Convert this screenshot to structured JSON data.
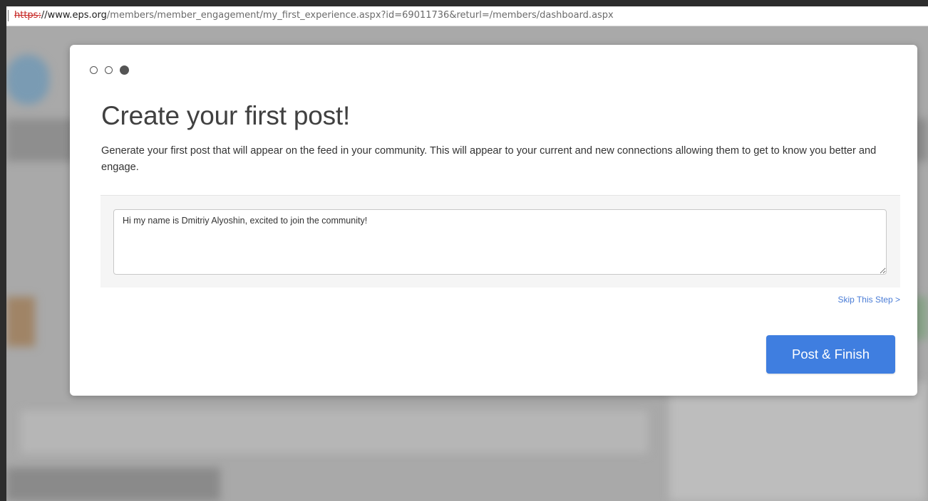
{
  "browser": {
    "url_scheme": "https:",
    "url_host": "//www.eps.org",
    "url_path": "/members/member_engagement/my_first_experience.aspx?id=69011736&returl=/members/dashboard.aspx"
  },
  "modal": {
    "steps": [
      {
        "state": "done"
      },
      {
        "state": "done"
      },
      {
        "state": "current"
      }
    ],
    "title": "Create your first post!",
    "description": "Generate your first post that will appear on the feed in your community. This will appear to your current and new connections allowing them to get to know you better and engage.",
    "post_text": "Hi my name is Dmitriy Alyoshin, excited to join the community!",
    "skip_label": "Skip This Step >",
    "submit_label": "Post & Finish"
  },
  "colors": {
    "accent": "#3f7ee0",
    "link": "#4a7cd6",
    "insecure_scheme": "#c5221f"
  }
}
